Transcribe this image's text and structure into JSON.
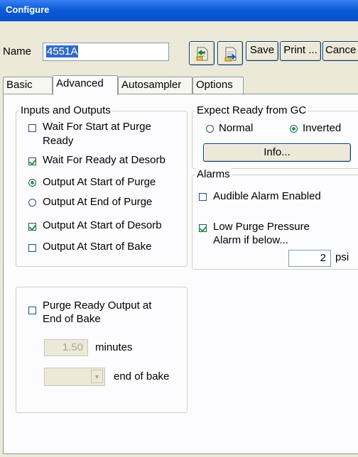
{
  "window": {
    "title": "Configure"
  },
  "name_field": {
    "label": "Name",
    "value": "4551A"
  },
  "toolbar": {
    "icon1": "import-icon",
    "icon2": "export-icon",
    "save_label": "Save",
    "print_label": "Print ...",
    "cancel_label": "Cance"
  },
  "tabs": [
    {
      "label": "Basic"
    },
    {
      "label": "Advanced"
    },
    {
      "label": "Autosampler"
    },
    {
      "label": "Options"
    }
  ],
  "inputs_outputs": {
    "legend": "Inputs and Outputs",
    "wait_start_purge": {
      "line1": "Wait For Start at Purge",
      "line2": "Ready",
      "checked": false
    },
    "wait_ready_desorb": {
      "label": "Wait For Ready at Desorb",
      "checked": true
    },
    "output_start_purge": {
      "label": "Output At Start of Purge",
      "selected": true
    },
    "output_end_purge": {
      "label": "Output At End of Purge",
      "selected": false
    },
    "output_start_desorb": {
      "label": "Output At Start of Desorb",
      "checked": true
    },
    "output_start_bake": {
      "label": "Output At Start of Bake",
      "checked": false
    }
  },
  "expect_ready": {
    "legend": "Expect Ready from GC",
    "normal_label": "Normal",
    "inverted_label": "Inverted",
    "selected": "inverted",
    "info_label": "Info..."
  },
  "alarms": {
    "legend": "Alarms",
    "audible": {
      "label": "Audible Alarm Enabled",
      "checked": false
    },
    "low_purge": {
      "line1": "Low Purge Pressure",
      "line2": "Alarm if below...",
      "checked": true
    },
    "pressure_value": "2",
    "pressure_unit": "psi"
  },
  "purge_ready": {
    "line1": "Purge Ready Output at",
    "line2": "End of Bake",
    "checked": false,
    "minutes_value": "1.50",
    "minutes_label": "minutes",
    "combo_value": "",
    "combo_suffix": "end of bake"
  }
}
